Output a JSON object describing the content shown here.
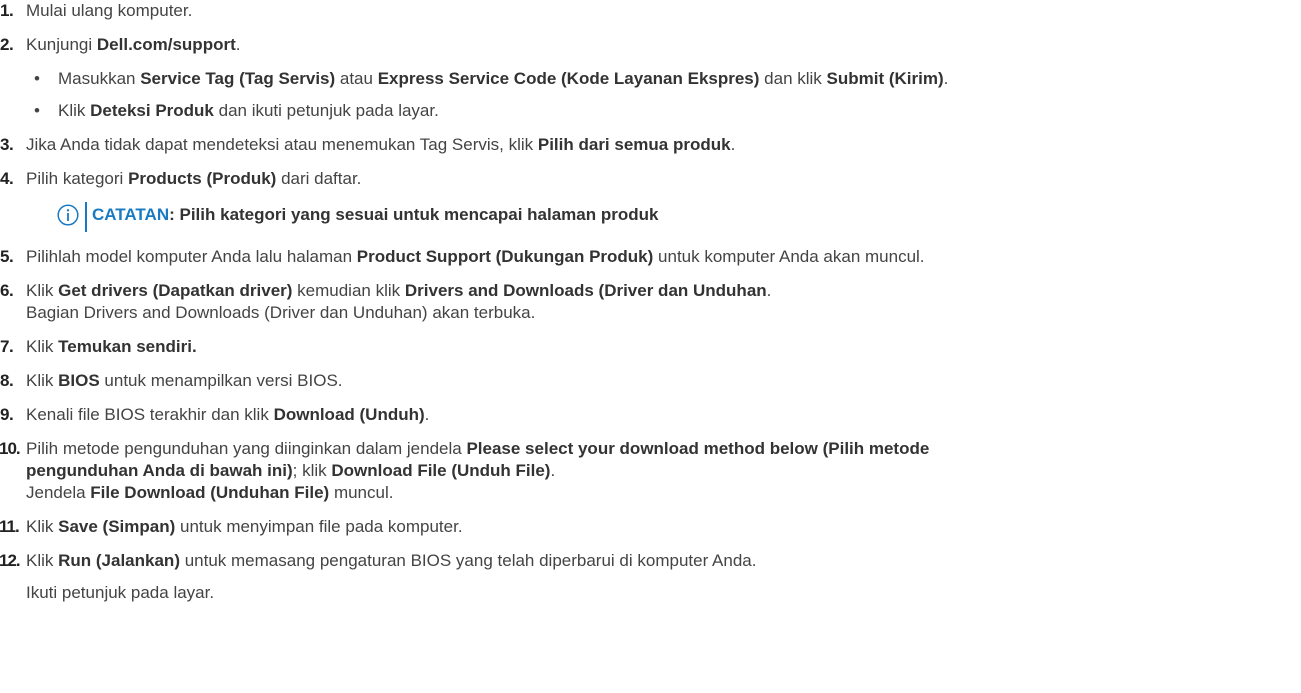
{
  "steps": [
    {
      "num": "1.",
      "parts": [
        {
          "t": "Mulai ulang komputer."
        }
      ]
    },
    {
      "num": "2.",
      "parts": [
        {
          "t": "Kunjungi "
        },
        {
          "b": "Dell.com/support"
        },
        {
          "t": "."
        }
      ],
      "sub": [
        [
          {
            "t": "Masukkan "
          },
          {
            "b": "Service Tag (Tag Servis)"
          },
          {
            "t": " atau "
          },
          {
            "b": "Express Service Code (Kode Layanan Ekspres)"
          },
          {
            "t": " dan klik "
          },
          {
            "b": "Submit (Kirim)"
          },
          {
            "t": "."
          }
        ],
        [
          {
            "t": "Klik "
          },
          {
            "b": "Deteksi Produk"
          },
          {
            "t": " dan ikuti petunjuk pada layar."
          }
        ]
      ]
    },
    {
      "num": "3.",
      "parts": [
        {
          "t": "Jika Anda tidak dapat mendeteksi atau menemukan Tag Servis, klik "
        },
        {
          "b": "Pilih dari semua produk"
        },
        {
          "t": "."
        }
      ]
    },
    {
      "num": "4.",
      "parts": [
        {
          "t": "Pilih kategori "
        },
        {
          "b": "Products (Produk)"
        },
        {
          "t": " dari daftar."
        }
      ],
      "note": {
        "label": "CATATAN",
        "text": ": Pilih kategori yang sesuai untuk mencapai halaman produk",
        "icon": "info-circle-icon",
        "accent": "#1a7ac1"
      }
    },
    {
      "num": "5.",
      "parts": [
        {
          "t": "Pilihlah model komputer Anda lalu halaman "
        },
        {
          "b": "Product Support (Dukungan Produk)"
        },
        {
          "t": " untuk komputer Anda akan muncul."
        }
      ]
    },
    {
      "num": "6.",
      "parts": [
        {
          "t": "Klik "
        },
        {
          "b": "Get drivers (Dapatkan driver)"
        },
        {
          "t": " kemudian klik "
        },
        {
          "b": "Drivers and Downloads (Driver dan Unduhan"
        },
        {
          "t": "."
        },
        {
          "br": true
        },
        {
          "t": "Bagian Drivers and Downloads (Driver dan Unduhan) akan terbuka."
        }
      ]
    },
    {
      "num": "7.",
      "parts": [
        {
          "t": "Klik "
        },
        {
          "b": "Temukan sendiri."
        }
      ]
    },
    {
      "num": "8.",
      "parts": [
        {
          "t": "Klik "
        },
        {
          "b": "BIOS"
        },
        {
          "t": " untuk menampilkan versi BIOS."
        }
      ]
    },
    {
      "num": "9.",
      "parts": [
        {
          "t": "Kenali file BIOS terakhir dan klik "
        },
        {
          "b": "Download (Unduh)"
        },
        {
          "t": "."
        }
      ]
    },
    {
      "num": "10.",
      "parts": [
        {
          "t": "Pilih metode pengunduhan yang diinginkan dalam jendela "
        },
        {
          "b": "Please select your download method below (Pilih metode"
        },
        {
          "br": true
        },
        {
          "b": "pengunduhan Anda di bawah ini)"
        },
        {
          "t": "; klik "
        },
        {
          "b": "Download File (Unduh File)"
        },
        {
          "t": "."
        },
        {
          "br": true
        },
        {
          "t": "Jendela "
        },
        {
          "b": "File Download (Unduhan File)"
        },
        {
          "t": " muncul."
        }
      ]
    },
    {
      "num": "11.",
      "parts": [
        {
          "t": "Klik "
        },
        {
          "b": "Save (Simpan)"
        },
        {
          "t": " untuk menyimpan file pada komputer."
        }
      ]
    },
    {
      "num": "12.",
      "parts": [
        {
          "t": "Klik "
        },
        {
          "b": "Run (Jalankan)"
        },
        {
          "t": " untuk memasang pengaturan BIOS yang telah diperbarui di komputer Anda."
        },
        {
          "brgap": true
        },
        {
          "t": "Ikuti petunjuk pada layar."
        }
      ]
    }
  ],
  "bullet_glyph": "•"
}
